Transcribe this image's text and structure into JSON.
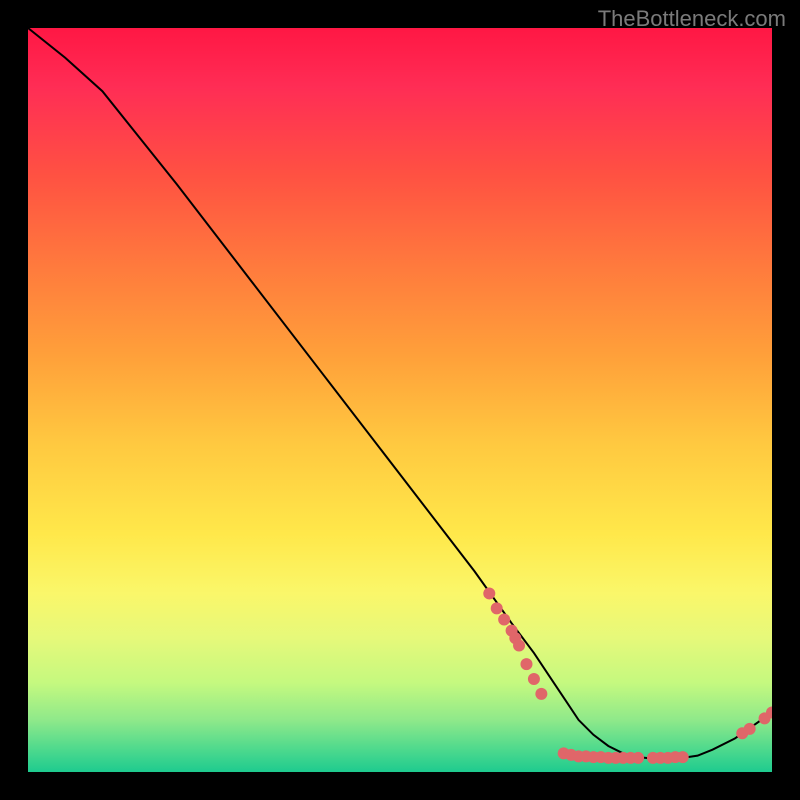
{
  "watermark": "TheBottleneck.com",
  "chart_data": {
    "type": "line",
    "title": "",
    "xlabel": "",
    "ylabel": "",
    "ylim": [
      0,
      100
    ],
    "xlim": [
      0,
      100
    ],
    "series": [
      {
        "name": "curve",
        "x": [
          0,
          5,
          10,
          20,
          30,
          40,
          50,
          60,
          65,
          68,
          70,
          72,
          74,
          76,
          78,
          80,
          82,
          84,
          86,
          88,
          90,
          92,
          95,
          100
        ],
        "y": [
          100,
          96,
          91.5,
          79,
          66,
          53,
          40,
          27,
          20,
          16,
          13,
          10,
          7,
          5,
          3.5,
          2.5,
          2,
          1.8,
          1.8,
          1.9,
          2.2,
          3,
          4.5,
          8
        ]
      },
      {
        "name": "markers",
        "points": [
          {
            "x": 62,
            "y": 24
          },
          {
            "x": 63,
            "y": 22
          },
          {
            "x": 64,
            "y": 20.5
          },
          {
            "x": 65,
            "y": 19
          },
          {
            "x": 65.5,
            "y": 18
          },
          {
            "x": 66,
            "y": 17
          },
          {
            "x": 67,
            "y": 14.5
          },
          {
            "x": 68,
            "y": 12.5
          },
          {
            "x": 69,
            "y": 10.5
          },
          {
            "x": 72,
            "y": 2.5
          },
          {
            "x": 73,
            "y": 2.3
          },
          {
            "x": 74,
            "y": 2.1
          },
          {
            "x": 75,
            "y": 2.1
          },
          {
            "x": 76,
            "y": 2.0
          },
          {
            "x": 77,
            "y": 2.0
          },
          {
            "x": 78,
            "y": 1.9
          },
          {
            "x": 79,
            "y": 1.9
          },
          {
            "x": 80,
            "y": 1.9
          },
          {
            "x": 81,
            "y": 1.9
          },
          {
            "x": 82,
            "y": 1.9
          },
          {
            "x": 84,
            "y": 1.9
          },
          {
            "x": 85,
            "y": 1.9
          },
          {
            "x": 86,
            "y": 1.9
          },
          {
            "x": 87,
            "y": 2.0
          },
          {
            "x": 88,
            "y": 2.0
          },
          {
            "x": 96,
            "y": 5.2
          },
          {
            "x": 97,
            "y": 5.8
          },
          {
            "x": 99,
            "y": 7.2
          },
          {
            "x": 100,
            "y": 8
          }
        ]
      }
    ],
    "colors": {
      "background_gradient_top": "#ff1744",
      "background_gradient_bottom": "#1ecb8f",
      "line": "#000000",
      "marker": "#e06669",
      "frame": "#000000"
    }
  }
}
